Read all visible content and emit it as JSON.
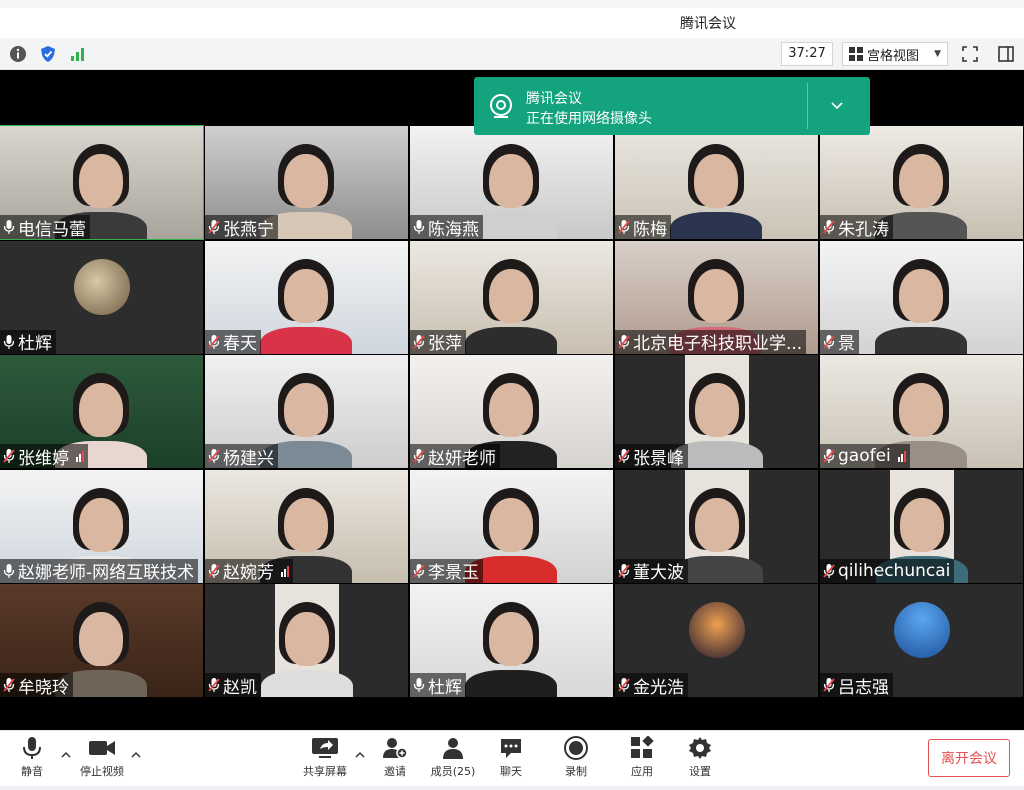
{
  "window": {
    "title": "腾讯会议"
  },
  "toolbar": {
    "timer": "37:27",
    "view_label": "宫格视图",
    "icons": [
      "info-icon",
      "shield-icon",
      "signal-icon",
      "fullscreen-icon",
      "sidebar-toggle-icon"
    ]
  },
  "banner": {
    "line1": "腾讯会议",
    "line2": "正在使用网络摄像头"
  },
  "participants": [
    {
      "name": "电信马蕾",
      "mic": "on"
    },
    {
      "name": "张燕宁",
      "mic": "muted"
    },
    {
      "name": "陈海燕",
      "mic": "on"
    },
    {
      "name": "陈梅",
      "mic": "muted"
    },
    {
      "name": "朱孔涛",
      "mic": "muted"
    },
    {
      "name": "杜辉",
      "mic": "on"
    },
    {
      "name": "春天",
      "mic": "muted"
    },
    {
      "name": "张萍",
      "mic": "muted"
    },
    {
      "name": "北京电子科技职业学...",
      "mic": "muted"
    },
    {
      "name": "景",
      "mic": "muted"
    },
    {
      "name": "张维婷",
      "mic": "muted",
      "signal": true
    },
    {
      "name": "杨建兴",
      "mic": "muted"
    },
    {
      "name": "赵妍老师",
      "mic": "muted"
    },
    {
      "name": "张景峰",
      "mic": "muted"
    },
    {
      "name": "gaofei",
      "mic": "muted",
      "signal": true
    },
    {
      "name": "赵娜老师-网络互联技术",
      "mic": "on"
    },
    {
      "name": "赵婉芳",
      "mic": "muted",
      "signal": true
    },
    {
      "name": "李景玉",
      "mic": "muted"
    },
    {
      "name": "董大波",
      "mic": "muted"
    },
    {
      "name": "qilihechuncai",
      "mic": "muted"
    },
    {
      "name": "牟晓玲",
      "mic": "muted"
    },
    {
      "name": "赵凯",
      "mic": "muted"
    },
    {
      "name": "杜辉",
      "mic": "on"
    },
    {
      "name": "金光浩",
      "mic": "muted"
    },
    {
      "name": "吕志强",
      "mic": "muted"
    }
  ],
  "bottombar": {
    "mute": "静音",
    "stop_video": "停止视频",
    "share_screen": "共享屏幕",
    "invite": "邀请",
    "members": "成员(25)",
    "chat": "聊天",
    "record": "录制",
    "apps": "应用",
    "settings": "设置",
    "leave": "离开会议"
  },
  "colors": {
    "banner": "#14a37f",
    "leave": "#e45151",
    "muted_mic": "#e5484d"
  }
}
